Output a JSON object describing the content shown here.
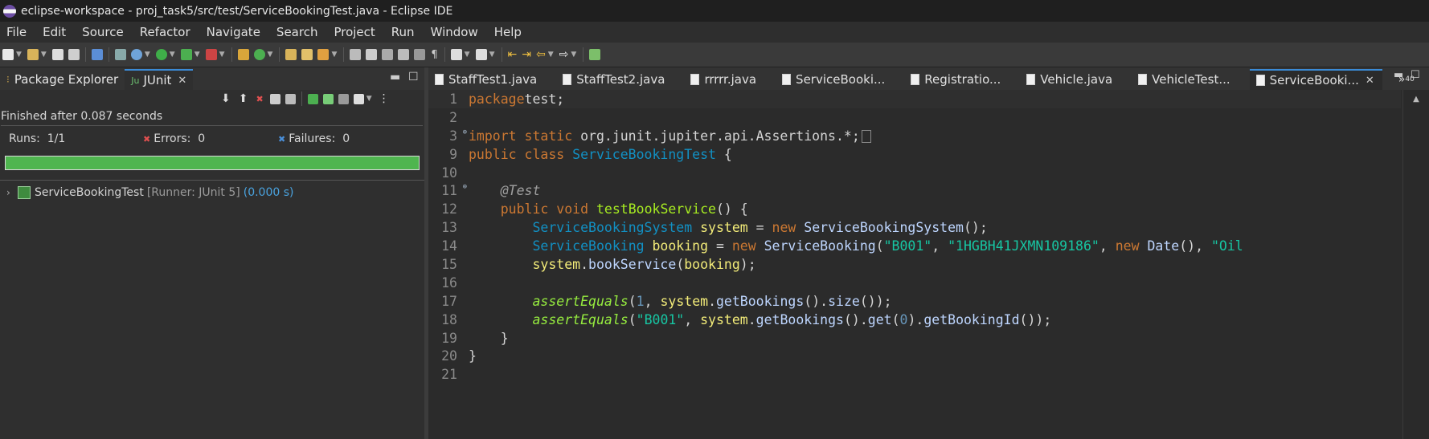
{
  "window": {
    "title": "eclipse-workspace - proj_task5/src/test/ServiceBookingTest.java - Eclipse IDE"
  },
  "menu": [
    "File",
    "Edit",
    "Source",
    "Refactor",
    "Navigate",
    "Search",
    "Project",
    "Run",
    "Window",
    "Help"
  ],
  "left_panel": {
    "tabs": [
      {
        "label": "Package Explorer",
        "active": false
      },
      {
        "label": "JUnit",
        "active": true
      }
    ],
    "status": "Finished after 0.087 seconds",
    "runs_label": "Runs:",
    "runs_value": "1/1",
    "errors_label": "Errors:",
    "errors_value": "0",
    "failures_label": "Failures:",
    "failures_value": "0",
    "progress": 1.0,
    "tree": {
      "name": "ServiceBookingTest",
      "runner": "[Runner: JUnit 5]",
      "time": "(0.000 s)"
    }
  },
  "editor": {
    "tabs": [
      {
        "label": "StaffTest1.java",
        "active": false
      },
      {
        "label": "StaffTest2.java",
        "active": false
      },
      {
        "label": "rrrrr.java",
        "active": false
      },
      {
        "label": "ServiceBooki...",
        "active": false
      },
      {
        "label": "Registratio...",
        "active": false
      },
      {
        "label": "Vehicle.java",
        "active": false
      },
      {
        "label": "VehicleTest...",
        "active": false
      },
      {
        "label": "ServiceBooki...",
        "active": true
      }
    ],
    "overflow_label": "»",
    "overflow_count": "40",
    "lines": [
      {
        "n": "1",
        "tokens": [
          [
            "kw",
            "package"
          ],
          [
            "",
            "test;"
          ]
        ]
      },
      {
        "n": "2",
        "tokens": []
      },
      {
        "n": "3",
        "fold": true,
        "tokens": [
          [
            "kw",
            "import static"
          ],
          [
            "",
            " org.junit.jupiter.api.Assertions.*;"
          ]
        ],
        "box": true
      },
      {
        "n": "9",
        "tokens": [
          [
            "kw",
            "public class "
          ],
          [
            "cls",
            "ServiceBookingTest"
          ],
          [
            "",
            " {"
          ]
        ]
      },
      {
        "n": "10",
        "tokens": []
      },
      {
        "n": "11",
        "fold": true,
        "tokens": [
          [
            "",
            "    "
          ],
          [
            "ann",
            "@Test"
          ]
        ]
      },
      {
        "n": "12",
        "tokens": [
          [
            "",
            "    "
          ],
          [
            "kw",
            "public void "
          ],
          [
            "meth",
            "testBookService"
          ],
          [
            "",
            "() {"
          ]
        ]
      },
      {
        "n": "13",
        "tokens": [
          [
            "",
            "        "
          ],
          [
            "cls",
            "ServiceBookingSystem "
          ],
          [
            "var",
            "system"
          ],
          [
            "",
            " = "
          ],
          [
            "kw",
            "new "
          ],
          [
            "fn",
            "ServiceBookingSystem"
          ],
          [
            "",
            "();"
          ]
        ]
      },
      {
        "n": "14",
        "tokens": [
          [
            "",
            "        "
          ],
          [
            "cls",
            "ServiceBooking "
          ],
          [
            "var",
            "booking"
          ],
          [
            "",
            " = "
          ],
          [
            "kw",
            "new "
          ],
          [
            "fn",
            "ServiceBooking"
          ],
          [
            "",
            "("
          ],
          [
            "str",
            "\"B001\""
          ],
          [
            "",
            ", "
          ],
          [
            "str",
            "\"1HGBH41JXMN109186\""
          ],
          [
            "",
            ", "
          ],
          [
            "kw",
            "new "
          ],
          [
            "fn",
            "Date"
          ],
          [
            "",
            "(), "
          ],
          [
            "str",
            "\"Oil"
          ]
        ]
      },
      {
        "n": "15",
        "tokens": [
          [
            "",
            "        "
          ],
          [
            "var",
            "system"
          ],
          [
            "",
            "."
          ],
          [
            "fn",
            "bookService"
          ],
          [
            "",
            "("
          ],
          [
            "var",
            "booking"
          ],
          [
            "",
            ");"
          ]
        ]
      },
      {
        "n": "16",
        "tokens": []
      },
      {
        "n": "17",
        "tokens": [
          [
            "",
            "        "
          ],
          [
            "sm",
            "assertEquals"
          ],
          [
            "",
            "("
          ],
          [
            "num",
            "1"
          ],
          [
            "",
            ", "
          ],
          [
            "var",
            "system"
          ],
          [
            "",
            "."
          ],
          [
            "fn",
            "getBookings"
          ],
          [
            "",
            "()."
          ],
          [
            "fn",
            "size"
          ],
          [
            "",
            "());"
          ]
        ]
      },
      {
        "n": "18",
        "tokens": [
          [
            "",
            "        "
          ],
          [
            "sm",
            "assertEquals"
          ],
          [
            "",
            "("
          ],
          [
            "str",
            "\"B001\""
          ],
          [
            "",
            ", "
          ],
          [
            "var",
            "system"
          ],
          [
            "",
            "."
          ],
          [
            "fn",
            "getBookings"
          ],
          [
            "",
            "()."
          ],
          [
            "fn",
            "get"
          ],
          [
            "",
            "("
          ],
          [
            "num",
            "0"
          ],
          [
            "",
            ")."
          ],
          [
            "fn",
            "getBookingId"
          ],
          [
            "",
            "());"
          ]
        ]
      },
      {
        "n": "19",
        "tokens": [
          [
            "",
            "    }"
          ]
        ]
      },
      {
        "n": "20",
        "tokens": [
          [
            "",
            "}"
          ]
        ]
      },
      {
        "n": "21",
        "tokens": []
      }
    ]
  },
  "colors": {
    "accent": "#3b8bd6",
    "progress": "#4fb54f",
    "keyword": "#cc7832",
    "class": "#1290c3",
    "string": "#17c6a3"
  }
}
